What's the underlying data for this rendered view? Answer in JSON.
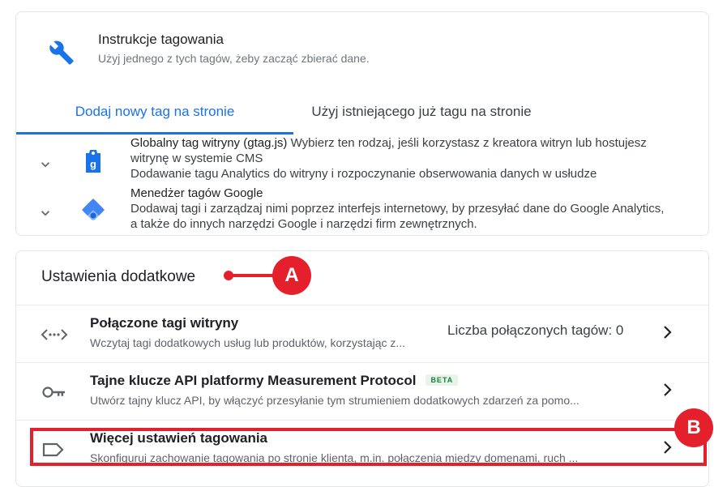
{
  "tagging": {
    "title": "Instrukcje tagowania",
    "subtitle": "Użyj jednego z tych tagów, żeby zacząć zbierać dane.",
    "tabs": [
      {
        "label": "Dodaj nowy tag na stronie",
        "active": true
      },
      {
        "label": "Użyj istniejącego już tagu na stronie",
        "active": false
      }
    ],
    "options": [
      {
        "title": "Globalny tag witryny (gtag.js)",
        "desc1": " Wybierz ten rodzaj, jeśli korzystasz z kreatora witryn lub hostujesz witrynę w systemie CMS",
        "desc2": "Dodawanie tagu Analytics do witryny i rozpoczynanie obserwowania danych w usłudze",
        "icon": "gtag-icon"
      },
      {
        "title": "Menedżer tagów Google",
        "desc1": "Dodawaj tagi i zarządzaj nimi poprzez interfejs internetowy, by przesyłać dane do Google Analytics, a także do innych narzędzi Google i narzędzi firm zewnętrznych.",
        "icon": "tag-manager-icon"
      }
    ]
  },
  "additional": {
    "title": "Ustawienia dodatkowe",
    "rows": [
      {
        "title": "Połączone tagi witryny",
        "desc": "Wczytaj tagi dodatkowych usług lub produktów, korzystając z...",
        "meta": "Liczba połączonych tagów: 0",
        "icon": "code-arrows-icon"
      },
      {
        "title": "Tajne klucze API platformy Measurement Protocol",
        "badge": "BETA",
        "desc": "Utwórz tajny klucz API, by włączyć przesyłanie tym strumieniem dodatkowych zdarzeń za pomo...",
        "icon": "key-icon"
      },
      {
        "title": "Więcej ustawień tagowania",
        "desc": "Skonfiguruj zachowanie tagowania po stronie klienta, m.in. połączenia między domenami, ruch ...",
        "icon": "label-icon"
      }
    ]
  },
  "annotations": {
    "a": "A",
    "b": "B",
    "color": "#e3202b"
  },
  "colors": {
    "accent": "#1a73e8",
    "gtm_blue": "#4285f4"
  }
}
